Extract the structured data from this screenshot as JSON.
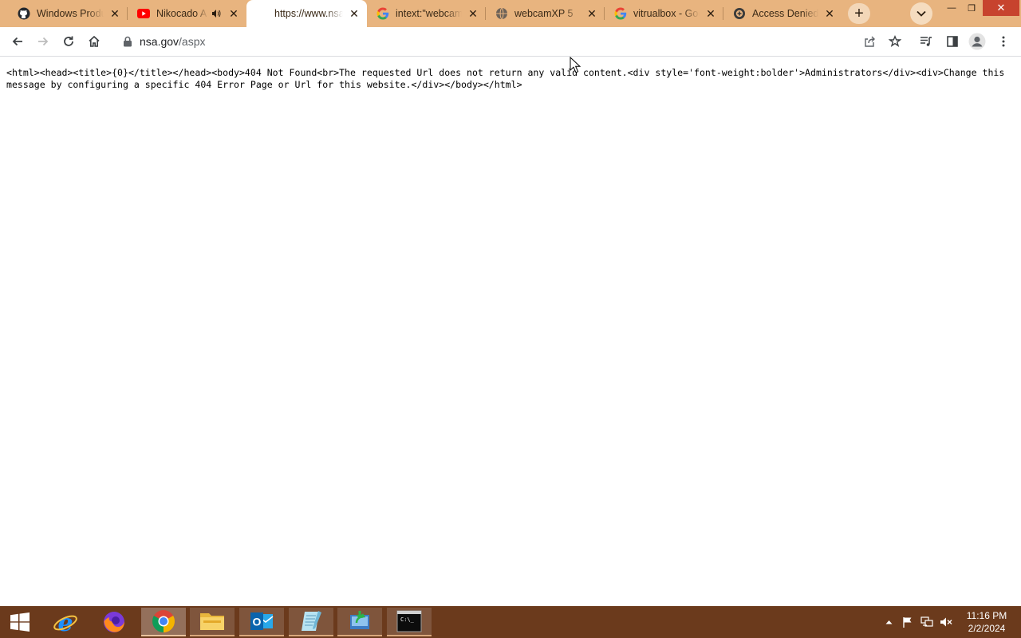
{
  "browser": {
    "tabs": [
      {
        "title": "Windows Produ",
        "icon": "github-icon",
        "active": false,
        "audio": false
      },
      {
        "title": "Nikocado A",
        "icon": "youtube-icon",
        "active": false,
        "audio": true
      },
      {
        "title": "https://www.nsa",
        "icon": "none",
        "active": true,
        "audio": false
      },
      {
        "title": "intext:\"webcam",
        "icon": "google-icon",
        "active": false,
        "audio": false
      },
      {
        "title": "webcamXP 5",
        "icon": "globe-icon",
        "active": false,
        "audio": false
      },
      {
        "title": "vitrualbox - Goo",
        "icon": "google-icon",
        "active": false,
        "audio": false
      },
      {
        "title": "Access Denied",
        "icon": "shield-icon",
        "active": false,
        "audio": false
      }
    ],
    "new_tab_symbol": "+",
    "tab_search_symbol": "⌄",
    "window_controls": {
      "minimize": "—",
      "restore": "❐",
      "close": "✕"
    }
  },
  "toolbar": {
    "address": {
      "host": "nsa.gov",
      "path": "/aspx"
    }
  },
  "page": {
    "raw_text": "<html><head><title>{0}</title></head><body>404 Not Found<br>The requested Url does not return any valid content.<div style='font-weight:bolder'>Administrators</div><div>Change this message by configuring a specific 404 Error Page or Url for this website.</div></body></html>"
  },
  "taskbar": {
    "apps": [
      "internet-explorer-icon",
      "firefox-icon",
      "chrome-icon",
      "file-explorer-icon",
      "outlook-icon",
      "notepad-icon",
      "sync-app-icon",
      "command-prompt-icon"
    ],
    "time": "11:16 PM",
    "date": "2/2/2024"
  },
  "colors": {
    "tab_strip": "#e8b47f",
    "taskbar": "#6b3a1c",
    "active_tab": "#ffffff"
  }
}
